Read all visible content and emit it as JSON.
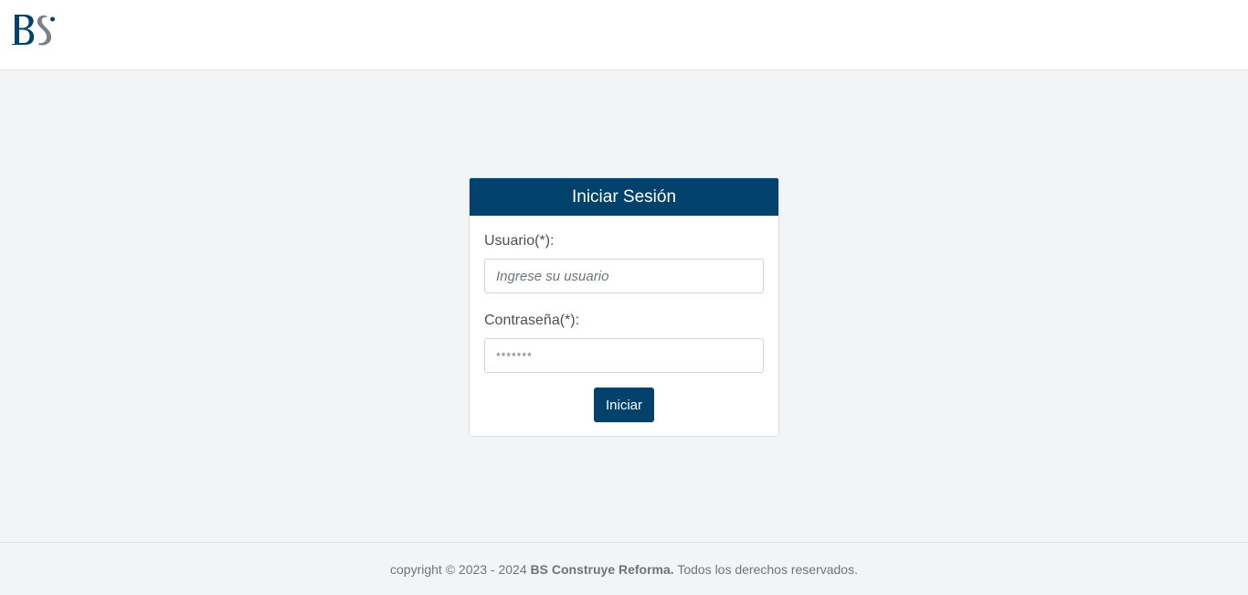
{
  "header": {
    "logo_text": "BS"
  },
  "login": {
    "title": "Iniciar Sesión",
    "user_label": "Usuario(*):",
    "user_placeholder": "Ingrese su usuario",
    "password_label": "Contraseña(*):",
    "password_placeholder": "*******",
    "submit_label": "Iniciar"
  },
  "footer": {
    "prefix": "copyright © 2023 - 2024 ",
    "company": "BS Construye Reforma.",
    "suffix": " Todos los derechos reservados."
  },
  "colors": {
    "brand": "#00426b",
    "background": "#f3f4f6"
  }
}
